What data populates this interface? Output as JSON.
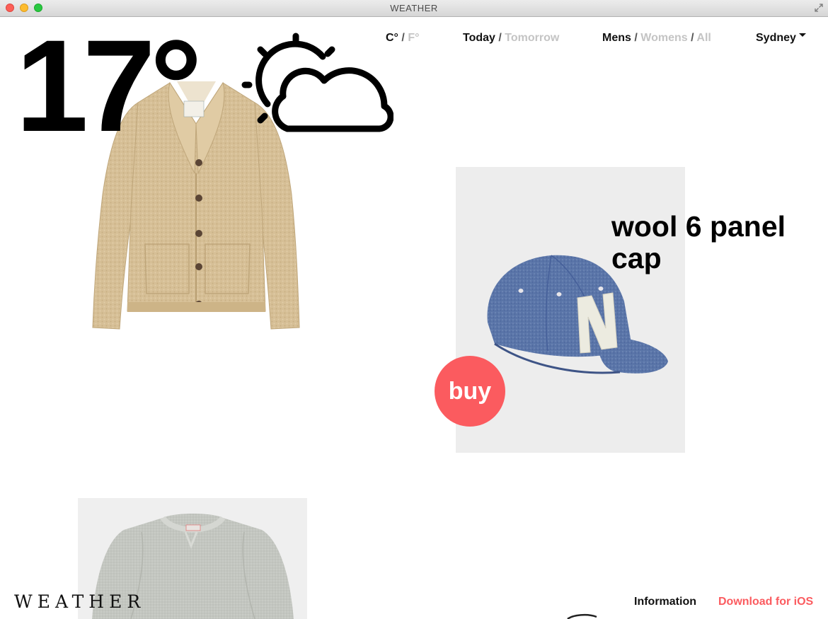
{
  "window": {
    "title": "WEATHER"
  },
  "weather": {
    "temperature": "17°",
    "icon": "partly-cloudy-icon"
  },
  "nav": {
    "unit": {
      "active": "C°",
      "inactive": "F°"
    },
    "day": {
      "active": "Today",
      "inactive": "Tomorrow"
    },
    "gender": {
      "active": "Mens",
      "option2": "Womens",
      "option3": "All"
    },
    "city": "Sydney",
    "separator": "/"
  },
  "product": {
    "title": "wool 6 panel cap",
    "buy_label": "buy"
  },
  "footer": {
    "logo": "WEATHER",
    "info_label": "Information",
    "download_label": "Download for iOS"
  },
  "colors": {
    "accent": "#fb5b5f",
    "inactive": "#c4c4c4",
    "cardigan": "#d6bf96",
    "cap": "#5a75a8"
  }
}
